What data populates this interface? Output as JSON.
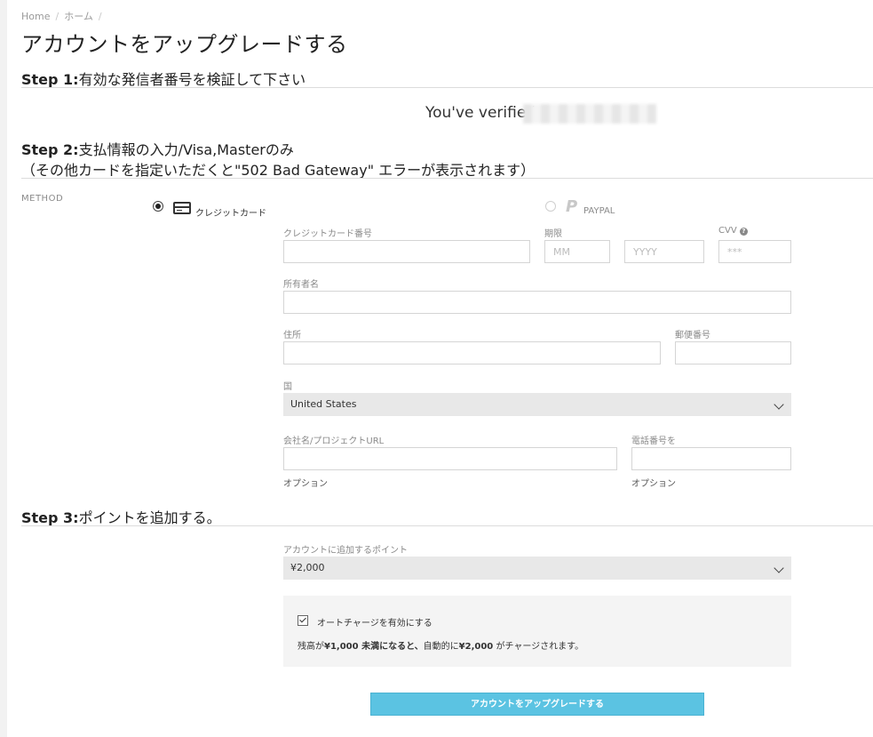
{
  "breadcrumb": {
    "items": [
      "Home",
      "ホーム"
    ],
    "sep": "/"
  },
  "page_title": "アカウントをアップグレードする",
  "step1": {
    "prefix": "Step 1:",
    "text": "有効な発信者番号を検証して下さい",
    "verified_text": "You've verified"
  },
  "step2": {
    "prefix": "Step 2:",
    "text": "支払情報の入力/Visa,Masterのみ",
    "note": "（その他カードを指定いただくと\"502 Bad Gateway\" エラーが表示されます）"
  },
  "method": {
    "label": "METHOD",
    "credit_label": "クレジットカード",
    "paypal_label": "PAYPAL",
    "paypal_icon": "paypal-icon",
    "credit_icon": "credit-card-icon"
  },
  "form": {
    "card_number_label": "クレジットカード番号",
    "expiry_label": "期限",
    "mm_placeholder": "MM",
    "yyyy_placeholder": "YYYY",
    "cvv_label": "CVV",
    "cvv_placeholder": "***",
    "holder_label": "所有者名",
    "address_label": "住所",
    "zip_label": "郵便番号",
    "country_label": "国",
    "country_value": "United States",
    "company_label": "会社名/プロジェクトURL",
    "phone_label": "電話番号を",
    "optional": "オプション"
  },
  "step3": {
    "prefix": "Step 3:",
    "text": "ポイントを追加する。",
    "points_label": "アカウントに追加するポイント",
    "points_value": "¥2,000",
    "auto_label": "オートチャージを有効にする",
    "note_a": "残高が",
    "note_b": "¥1,000 未満になると、",
    "note_c": "自動的に",
    "note_d": "¥2,000",
    "note_e": " がチャージされます。"
  },
  "submit_label": "アカウントをアップグレードする",
  "colors": {
    "accent": "#5bc3e2",
    "select_bg": "#e8e8e8"
  }
}
